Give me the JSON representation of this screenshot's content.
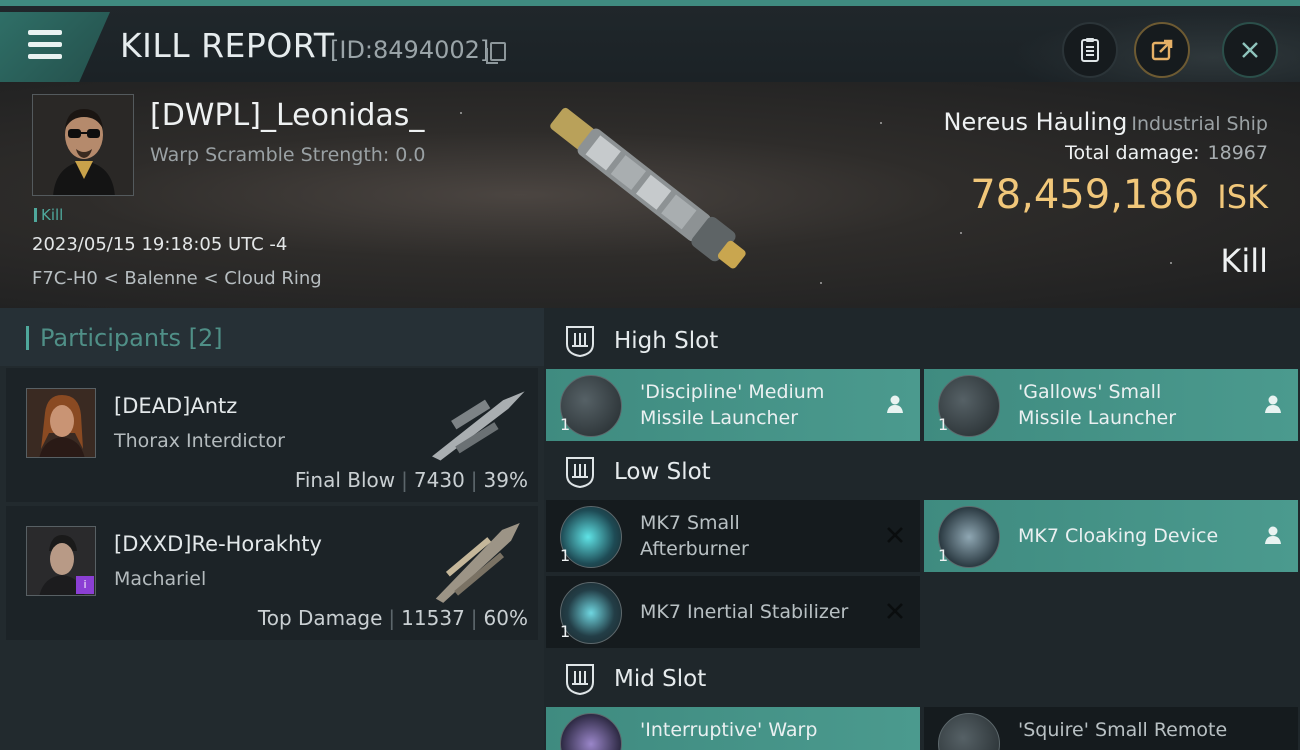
{
  "header": {
    "title": "KILL REPORT",
    "report_id": "[ID:8494002]"
  },
  "victim": {
    "name": "[DWPL]_Leonidas_",
    "warp_scramble": "Warp Scramble Strength: 0.0",
    "tag": "Kill",
    "datetime": "2023/05/15 19:18:05 UTC -4",
    "location": "F7C-H0 < Balenne < Cloud Ring",
    "ship_name": "Nereus Hauling",
    "ship_class": "Industrial Ship",
    "total_damage_label": "Total damage:",
    "total_damage_value": "18967",
    "isk_value": "78,459,186",
    "isk_unit": "ISK",
    "result": "Kill"
  },
  "participants": {
    "title": "Participants [2]",
    "rows": [
      {
        "name": "[DEAD]Antz",
        "ship": "Thorax Interdictor",
        "role": "Final Blow",
        "damage": "7430",
        "percent": "39%"
      },
      {
        "name": "[DXXD]Re-Horakhty",
        "ship": "Machariel",
        "role": "Top Damage",
        "damage": "11537",
        "percent": "60%"
      }
    ]
  },
  "fitting": {
    "high_slot_label": "High Slot",
    "low_slot_label": "Low Slot",
    "mid_slot_label": "Mid Slot",
    "high": [
      {
        "line1": "'Discipline' Medium",
        "line2": "Missile Launcher",
        "qty": "1",
        "state": "fit"
      },
      {
        "line1": "'Gallows' Small",
        "line2": "Missile Launcher",
        "qty": "1",
        "state": "fit"
      }
    ],
    "low": [
      {
        "line1": "MK7 Small",
        "line2": "Afterburner",
        "qty": "1",
        "state": "destroyed"
      },
      {
        "line1": "MK7 Cloaking Device",
        "line2": "",
        "qty": "1",
        "state": "fit"
      },
      {
        "line1": "MK7 Inertial Stabilizer",
        "line2": "",
        "qty": "1",
        "state": "destroyed"
      }
    ],
    "mid": [
      {
        "line1": "'Interruptive' Warp",
        "line2": "",
        "qty": "",
        "state": "fit"
      },
      {
        "line1": "'Squire' Small Remote",
        "line2": "",
        "qty": "",
        "state": "destroyed"
      }
    ]
  },
  "colors": {
    "accent": "#3f8b80",
    "isk": "#f1c77a"
  }
}
